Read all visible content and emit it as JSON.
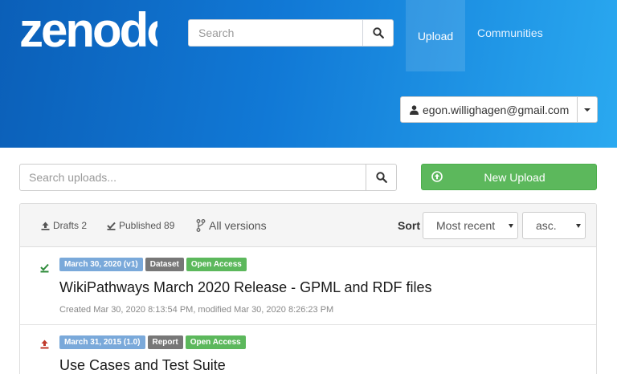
{
  "header": {
    "logo_text": "zenodo",
    "search_placeholder": "Search",
    "nav": {
      "upload": "Upload",
      "communities": "Communities"
    },
    "user_email": "egon.willighagen@gmail.com"
  },
  "uploads": {
    "search_placeholder": "Search uploads...",
    "new_upload_label": "New Upload",
    "tabs": {
      "drafts": "Drafts 2",
      "published": "Published 89",
      "versions": "All versions"
    },
    "sort_label": "Sort",
    "sort_by": "Most recent",
    "sort_order": "asc."
  },
  "records": [
    {
      "status": "published",
      "date_badge": "March 30, 2020 (v1)",
      "type_badge": "Dataset",
      "access_badge": "Open Access",
      "title": "WikiPathways March 2020 Release - GPML and RDF files",
      "meta": "Created Mar 30, 2020 8:13:54 PM, modified Mar 30, 2020 8:26:23 PM"
    },
    {
      "status": "upload",
      "date_badge": "March 31, 2015 (1.0)",
      "type_badge": "Report",
      "access_badge": "Open Access",
      "title": "Use Cases and Test Suite",
      "meta": ""
    }
  ],
  "colors": {
    "header_start": "#0b5fb8",
    "header_end": "#2aa9f0",
    "success": "#5cb85c",
    "date_badge": "#7aa9da",
    "type_badge": "#777777",
    "published_icon": "#2e8b3a",
    "upload_icon": "#c0392b"
  }
}
